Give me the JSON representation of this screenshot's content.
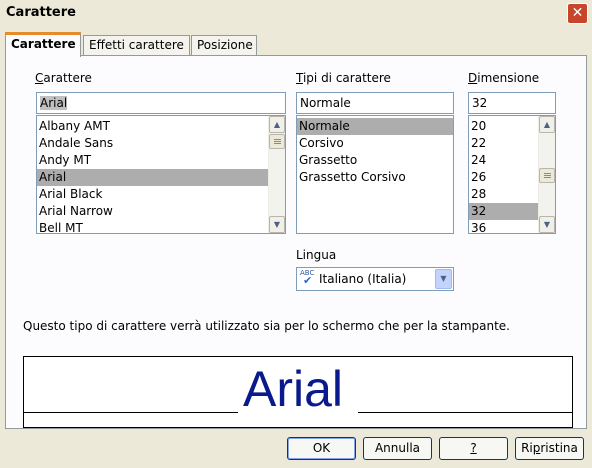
{
  "window": {
    "title": "Carattere"
  },
  "tabs": [
    {
      "label": "Carattere"
    },
    {
      "label": "Effetti carattere"
    },
    {
      "label": "Posizione"
    }
  ],
  "font": {
    "label_underlined": "C",
    "label_rest": "arattere",
    "value": "Arial",
    "items": [
      "Albany AMT",
      "Andale Sans",
      "Andy MT",
      "Arial",
      "Arial Black",
      "Arial Narrow",
      "Bell MT"
    ]
  },
  "style": {
    "label_underlined": "T",
    "label_rest": "ipi di carattere",
    "value": "Normale",
    "items": [
      "Normale",
      "Corsivo",
      "Grassetto",
      "Grassetto Corsivo"
    ]
  },
  "size": {
    "label_underlined": "D",
    "label_rest": "imensione",
    "value": "32",
    "items": [
      "20",
      "22",
      "24",
      "26",
      "28",
      "32",
      "36"
    ]
  },
  "language": {
    "label": "Lingua",
    "value": "Italiano (Italia)",
    "icon_text": "ABC"
  },
  "info_text": "Questo tipo di carattere verrà utilizzato sia per lo schermo che per la stampante.",
  "preview": {
    "text": "Arial"
  },
  "buttons": {
    "ok": "OK",
    "cancel": "Annulla",
    "help": "?",
    "reset_before": "Ri",
    "reset_underlined": "p",
    "reset_after": "ristina"
  },
  "icons": {
    "close": "close-icon",
    "scroll_up": "arrow-up-icon",
    "scroll_down": "arrow-down-icon",
    "dropdown": "chevron-down-icon",
    "spellcheck": "spellcheck-icon"
  }
}
